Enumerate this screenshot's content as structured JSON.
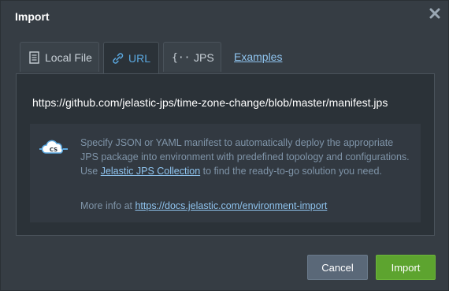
{
  "dialog": {
    "title": "Import",
    "close_icon": "close-icon"
  },
  "tabs": [
    {
      "label": "Local File",
      "icon": "document-icon",
      "active": false
    },
    {
      "label": "URL",
      "icon": "link-icon",
      "active": true
    },
    {
      "label": "JPS",
      "icon": "braces-icon",
      "active": false
    }
  ],
  "examples_link": "Examples",
  "url_field": {
    "value": "https://github.com/jelastic-jps/time-zone-change/blob/master/manifest.jps"
  },
  "info": {
    "icon": "cloud-script-icon",
    "icon_text": "CS",
    "line1": "Specify JSON or YAML manifest to automatically deploy the appropriate JPS package into environment with predefined topology and configurations.",
    "use_prefix": "Use ",
    "collection_link": "Jelastic JPS Collection",
    "use_suffix": " to find the ready-to-go solution you need.",
    "more_prefix": "More info at ",
    "more_link": "https://docs.jelastic.com/environment-import"
  },
  "buttons": {
    "cancel": "Cancel",
    "import": "Import"
  },
  "colors": {
    "accent": "#5ba8e0",
    "link": "#8fc4ef",
    "import_button": "#5da42f",
    "cancel_button": "#5a6878"
  }
}
